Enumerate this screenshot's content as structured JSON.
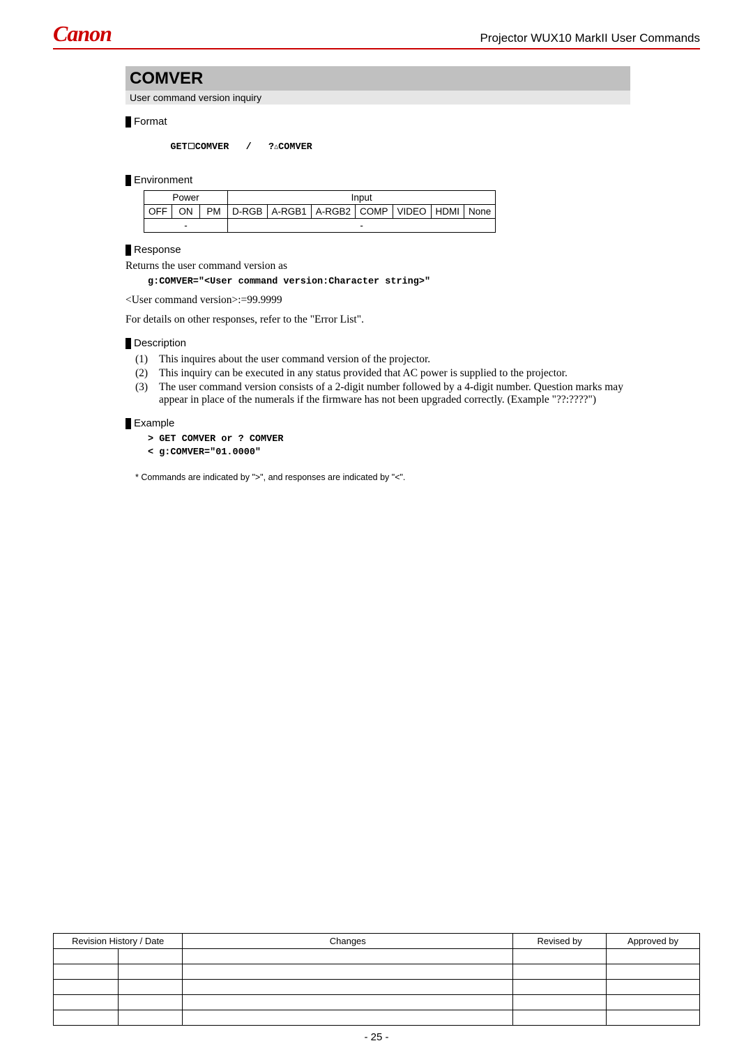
{
  "header": {
    "logo_text": "Canon",
    "doc_title": "Projector WUX10 MarkII User Commands"
  },
  "command": {
    "name": "COMVER",
    "brief": "User command version inquiry"
  },
  "sections": {
    "format_head": "Format",
    "environment_head": "Environment",
    "response_head": "Response",
    "description_head": "Description",
    "example_head": "Example"
  },
  "format": {
    "prefix": "GET",
    "cmd1": "COMVER",
    "sep": "   /   ?",
    "cmd2": "COMVER"
  },
  "env_table": {
    "power_label": "Power",
    "input_label": "Input",
    "cols_power": [
      "OFF",
      "ON",
      "PM"
    ],
    "cols_input": [
      "D-RGB",
      "A-RGB1",
      "A-RGB2",
      "COMP",
      "VIDEO",
      "HDMI",
      "None"
    ],
    "power_value": "-",
    "input_value": "-"
  },
  "response": {
    "intro": "Returns the user command version as",
    "mono": "g:COMVER=\"<User command version:Character string>\"",
    "range": "<User command version>:=99.9999",
    "note": "For details on other responses, refer to the \"Error List\"."
  },
  "description": {
    "items": [
      {
        "n": "(1)",
        "t": "This inquires about the user command version of the projector."
      },
      {
        "n": "(2)",
        "t": "This inquiry can be executed in any status provided that AC power is supplied to the projector."
      },
      {
        "n": "(3)",
        "t": "The user command version consists of a 2-digit number followed by a 4-digit number. Question marks may appear in place of the numerals if the firmware has not been upgraded correctly. (Example \"??:????\")"
      }
    ]
  },
  "example": {
    "line1": "> GET COMVER or ? COMVER",
    "line2": "< g:COMVER=\"01.0000\"",
    "note": "* Commands are indicated by \">\", and responses are indicated by \"<\"."
  },
  "footer": {
    "rev_headers": [
      "Revision History / Date",
      "Changes",
      "Revised by",
      "Approved by"
    ],
    "page": "- 25 -"
  }
}
